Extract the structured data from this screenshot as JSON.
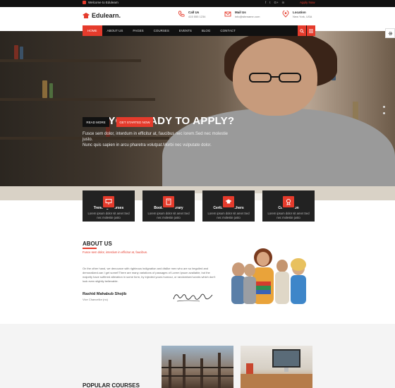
{
  "topbar": {
    "welcome": "Welcome to Edulearn",
    "social": [
      "f",
      "t",
      "G+",
      "in"
    ],
    "apply": "Apply Now"
  },
  "header": {
    "logo": "Edulearn.",
    "call": {
      "label": "Call Us",
      "value": "415 555 1234"
    },
    "mail": {
      "label": "Mail Us",
      "value": "info@sitename.com"
    },
    "location": {
      "label": "Location",
      "value": "New York, USA"
    }
  },
  "nav": {
    "items": [
      "HOME",
      "ABOUT US",
      "PAGES",
      "COURSES",
      "EVENTS",
      "BLOG",
      "CONTACT"
    ]
  },
  "hero": {
    "title": "ARE YOU READY TO APPLY?",
    "subtitle_1": "Fusce sem dolor, interdum in efficitur at, faucibus nec lorem.Sed nec molestie justo.",
    "subtitle_2": "Nunc quis sapien in arcu pharetra volutpat.Morbi nec vulputate dolor.",
    "read_more": "READ MORE",
    "get_started": "GET STARTED NOW"
  },
  "features": [
    {
      "title": "Trending Courses",
      "desc_1": "Lorem ipsum dolor sit amet Sed",
      "desc_2": "nec molestie justo",
      "icon": "presentation-icon"
    },
    {
      "title": "Books & Liberary",
      "desc_1": "Lorem ipsum dolor sit amet Sed",
      "desc_2": "nec molestie justo",
      "icon": "book-icon"
    },
    {
      "title": "Certified Teachers",
      "desc_1": "Lorem ipsum dolor sit amet Sed",
      "desc_2": "nec molestie justo",
      "icon": "graduation-cap-icon"
    },
    {
      "title": "Certification",
      "desc_1": "Lorem ipsum dolor sit amet Sed",
      "desc_2": "nec molestie justo",
      "icon": "certificate-icon"
    }
  ],
  "about": {
    "title": "ABOUT US",
    "subtitle": "Fusce sem dolor, interdum in efficitur at, faucibus.",
    "text": "On the other hand, we denounce with righteous indignation and dislike men who are so beguiled and demoralized.can I get some!!There are many variations of passages of Lorem Ipsum available, but the majority have suffered alteration in some form, by injected yours humour, or randomised words which don't look even slightly believable.",
    "name": "Rashid Mahabub Shojib",
    "role": "Vice Chancellor (nc)"
  },
  "popular": {
    "title": "POPULAR COURSES"
  },
  "colors": {
    "accent": "#e53b2c",
    "dark": "#111111"
  }
}
